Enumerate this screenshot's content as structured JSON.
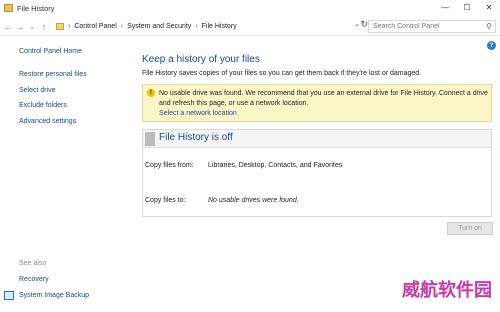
{
  "window": {
    "title": "File History"
  },
  "address": {
    "crumbs": [
      "Control Panel",
      "System and Security",
      "File History"
    ],
    "search_placeholder": "Search Control Panel"
  },
  "sidebar": {
    "home": "Control Panel Home",
    "links": [
      "Restore personal files",
      "Select drive",
      "Exclude folders",
      "Advanced settings"
    ],
    "see_also": "See also",
    "see_also_links": [
      "Recovery",
      "System Image Backup"
    ]
  },
  "main": {
    "title": "Keep a history of your files",
    "description": "File History saves copies of your files so you can get them back if they're lost or damaged.",
    "warning": {
      "text": "No usable drive was found. We recommend that you use an external drive for File History. Connect a drive and refresh this page, or use a network location.",
      "link": "Select a network location"
    },
    "status": {
      "title": "File History is off",
      "copy_from_label": "Copy files from:",
      "copy_from_value": "Libraries, Desktop, Contacts, and Favorites",
      "copy_to_label": "Copy files to:",
      "copy_to_value": "No usable drives were found."
    },
    "turn_on_label": "Turn on"
  },
  "watermark": "威航软件园",
  "colors": {
    "link": "#1a4a8a",
    "warning_bg": "#fbf6c8",
    "help": "#2b78d0",
    "watermark": "#c93aa8"
  },
  "icons": [
    "back-arrow-icon",
    "forward-arrow-icon",
    "up-arrow-icon",
    "refresh-icon",
    "search-icon",
    "help-icon",
    "warning-icon",
    "system-image-backup-icon"
  ]
}
